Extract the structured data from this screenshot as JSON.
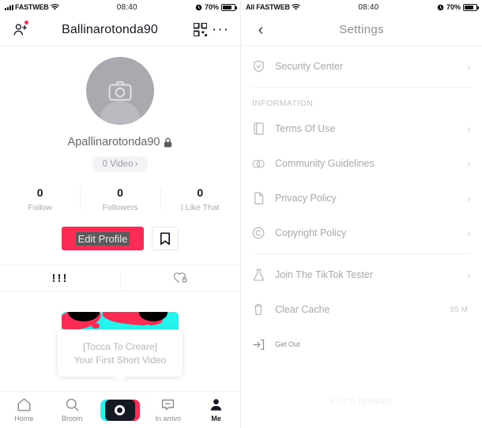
{
  "left": {
    "status": {
      "carrier": "FASTWEB",
      "time": "08:40",
      "battery": "70%"
    },
    "header": {
      "title": "Ballinarotonda90",
      "add_user_icon": "add-user-icon",
      "qr_icon": "qr-code-icon",
      "more_icon": "more-options-icon"
    },
    "profile": {
      "avatar_icon": "camera-icon",
      "username": "Apallinarotonda90",
      "lock_icon": "lock-icon",
      "video_pill": "0 Video",
      "stats": [
        {
          "value": "0",
          "label": "Follow"
        },
        {
          "value": "0",
          "label": "Followers"
        },
        {
          "value": "0",
          "label": "I Like That"
        }
      ],
      "edit_button": "Edit Profile",
      "bookmark_icon": "bookmark-icon"
    },
    "tabs": [
      {
        "icon": "grid-icon",
        "glyph": "!!!"
      },
      {
        "icon": "heart-lock-icon",
        "glyph": ""
      }
    ],
    "create_tip": {
      "line1": "[Tocca To Creare]",
      "line2": "Your First Short Video"
    },
    "bottom_nav": [
      {
        "label": "Home",
        "icon": "home-icon",
        "active": false
      },
      {
        "label": "Broom",
        "icon": "search-icon",
        "active": false
      },
      {
        "label": "",
        "icon": "camera-record-button",
        "active": false
      },
      {
        "label": "In arrivo",
        "icon": "inbox-icon",
        "active": false
      },
      {
        "label": "Me",
        "icon": "person-icon",
        "active": true
      }
    ]
  },
  "right": {
    "status": {
      "carrier": "All FASTWEB",
      "time": "08:40",
      "battery": "70%"
    },
    "header": {
      "back_icon": "back-chevron-icon",
      "title": "Settings"
    },
    "groups": [
      {
        "title": "",
        "items": [
          {
            "label": "Security Center",
            "icon": "shield-check-icon",
            "meta": "",
            "arrow": true
          }
        ]
      },
      {
        "title": "INFORMATION",
        "items": [
          {
            "label": "Terms Of Use",
            "icon": "book-icon",
            "meta": "",
            "arrow": true
          },
          {
            "label": "Community Guidelines",
            "icon": "rings-icon",
            "meta": "",
            "arrow": true
          },
          {
            "label": "Privacy Policy",
            "icon": "document-icon",
            "meta": "",
            "arrow": true
          },
          {
            "label": "Copyright Policy",
            "icon": "copyright-icon",
            "meta": "",
            "arrow": true
          }
        ]
      },
      {
        "title": "",
        "items": [
          {
            "label": "Join The TikTok Tester",
            "icon": "flask-icon",
            "meta": "",
            "arrow": true
          },
          {
            "label": "Clear Cache",
            "icon": "trash-icon",
            "meta": "85 M",
            "arrow": false
          },
          {
            "label": "Get Out",
            "icon": "logout-icon",
            "meta": "",
            "arrow": false
          }
        ]
      }
    ],
    "version": "V3.0.0 (300090)"
  },
  "colors": {
    "accent_red": "#fe2c55",
    "accent_cyan": "#25f4ee",
    "text_dark": "#161823"
  }
}
